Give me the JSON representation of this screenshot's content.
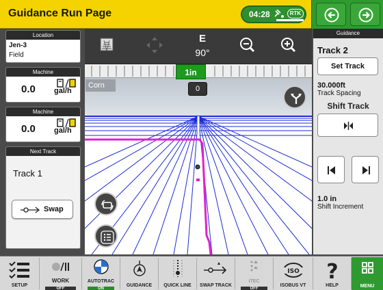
{
  "header": {
    "title": "Guidance Run Page",
    "time": "04:28",
    "rtk_label": "RTK"
  },
  "nav": {
    "back_icon": "circle-arrow-left-icon",
    "forward_icon": "circle-arrow-right-icon"
  },
  "left": {
    "location": {
      "header": "Location",
      "line1": "Jen-3",
      "line2": "Field"
    },
    "machine1": {
      "header": "Machine",
      "value": "0.0",
      "unit": "gal/h"
    },
    "machine2": {
      "header": "Machine",
      "value": "0.0",
      "unit": "gal/h"
    },
    "next_track": {
      "header": "Next Track",
      "track": "Track 1",
      "swap_label": "Swap"
    }
  },
  "toolbar": {
    "heading_letter": "E",
    "heading_degrees": "90°",
    "offset": "1in"
  },
  "view": {
    "crop": "Corn",
    "pass_count": "0"
  },
  "right": {
    "header": "Guidance",
    "track_name": "Track 2",
    "set_track_label": "Set Track",
    "track_spacing_value": "30.000ft",
    "track_spacing_label": "Track Spacing",
    "shift_title": "Shift Track",
    "shift_increment_value": "1.0 in",
    "shift_increment_label": "Shift Increment"
  },
  "bottom_bar": [
    {
      "label": "SETUP",
      "state": "",
      "icon": "settings-list-icon"
    },
    {
      "label": "WORK",
      "state": "OFF",
      "icon": "work-toggle-icon"
    },
    {
      "label": "AUTOTRAC",
      "state": "ON",
      "icon": "autotrac-icon"
    },
    {
      "label": "GUIDANCE",
      "state": "",
      "icon": "guidance-icon"
    },
    {
      "label": "QUICK LINE",
      "state": "",
      "icon": "quick-line-icon"
    },
    {
      "label": "SWAP TRACK",
      "state": "",
      "icon": "swap-track-icon"
    },
    {
      "label": "iTEC",
      "state": "OFF",
      "icon": "itec-icon"
    },
    {
      "label": "ISOBUS VT",
      "state": "",
      "icon": "isobus-icon"
    },
    {
      "label": "HELP",
      "state": "",
      "icon": "help-icon"
    },
    {
      "label": "MENU",
      "state": "",
      "icon": "menu-grid-icon"
    }
  ],
  "colors": {
    "header_yellow": "#f5d300",
    "accent_green": "#2f9a2f",
    "guidance_line": "#e020d0",
    "row_blue": "#1a2bd8"
  }
}
